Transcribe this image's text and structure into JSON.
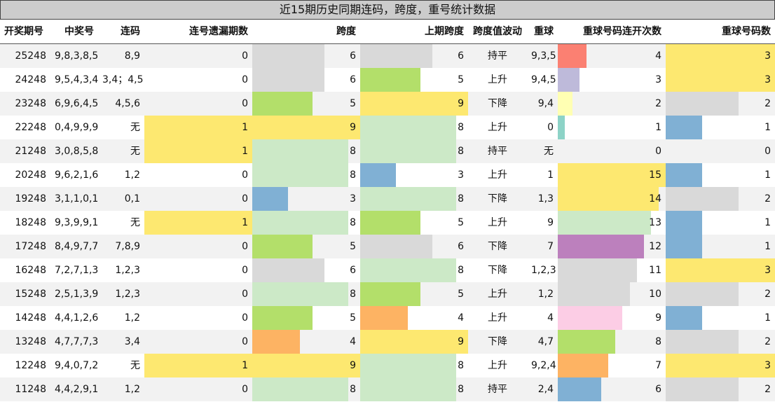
{
  "title": "近15期历史同期连码，跨度，重号统计数据",
  "headers": [
    "开奖期号",
    "中奖号",
    "连码",
    "连号遗漏期数",
    "跨度",
    "上期跨度",
    "跨度值波动",
    "重球",
    "重球号码连开次数",
    "重球号码数"
  ],
  "colors": {
    "yellow": "#fde870",
    "gray": "#d9d9d9",
    "lightgreen": "#cce9c7",
    "green": "#b3df6a",
    "blue": "#80b0d4",
    "orange": "#fdb363",
    "salmon": "#fb8072",
    "lavender": "#bebada",
    "lightyellow": "#ffffb3",
    "teal": "#8dd3c7",
    "pink": "#fccde5",
    "purple": "#bc80bd"
  },
  "rows": [
    {
      "issue": "25248",
      "numbers": "9,8,3,8,5",
      "consec": "8,9",
      "miss": "0",
      "span": "6",
      "span_color": "gray",
      "prev_span": "6",
      "prev_color": "gray",
      "trend": "持平",
      "repeat": "9,3,5",
      "repeat_times": "4",
      "times_color": "salmon",
      "repeat_count": "3",
      "count_color": "yellow"
    },
    {
      "issue": "24248",
      "numbers": "9,5,4,3,4",
      "consec": "3,4；4,5",
      "miss": "0",
      "span": "6",
      "span_color": "gray",
      "prev_span": "5",
      "prev_color": "green",
      "trend": "上升",
      "repeat": "9,4,5",
      "repeat_times": "3",
      "times_color": "lavender",
      "repeat_count": "3",
      "count_color": "yellow"
    },
    {
      "issue": "23248",
      "numbers": "6,9,6,4,5",
      "consec": "4,5,6",
      "miss": "0",
      "span": "5",
      "span_color": "green",
      "prev_span": "9",
      "prev_color": "yellow",
      "trend": "下降",
      "repeat": "9,4",
      "repeat_times": "2",
      "times_color": "lightyellow",
      "repeat_count": "2",
      "count_color": "gray"
    },
    {
      "issue": "22248",
      "numbers": "0,4,9,9,9",
      "consec": "无",
      "miss": "1",
      "span": "9",
      "span_color": "yellow",
      "prev_span": "8",
      "prev_color": "lightgreen",
      "trend": "上升",
      "repeat": "0",
      "repeat_times": "1",
      "times_color": "teal",
      "repeat_count": "1",
      "count_color": "blue"
    },
    {
      "issue": "21248",
      "numbers": "3,0,8,5,8",
      "consec": "无",
      "miss": "1",
      "span": "8",
      "span_color": "lightgreen",
      "prev_span": "8",
      "prev_color": "lightgreen",
      "trend": "持平",
      "repeat": "无",
      "repeat_times": "0",
      "times_color": "",
      "repeat_count": "0",
      "count_color": ""
    },
    {
      "issue": "20248",
      "numbers": "9,6,2,1,6",
      "consec": "1,2",
      "miss": "0",
      "span": "8",
      "span_color": "lightgreen",
      "prev_span": "3",
      "prev_color": "blue",
      "trend": "上升",
      "repeat": "1",
      "repeat_times": "15",
      "times_color": "yellow",
      "repeat_count": "1",
      "count_color": "blue"
    },
    {
      "issue": "19248",
      "numbers": "3,1,1,0,1",
      "consec": "0,1",
      "miss": "0",
      "span": "3",
      "span_color": "blue",
      "prev_span": "8",
      "prev_color": "lightgreen",
      "trend": "下降",
      "repeat": "1,3",
      "repeat_times": "14",
      "times_color": "yellow",
      "repeat_count": "2",
      "count_color": "gray"
    },
    {
      "issue": "18248",
      "numbers": "9,3,9,9,1",
      "consec": "无",
      "miss": "1",
      "span": "8",
      "span_color": "lightgreen",
      "prev_span": "5",
      "prev_color": "green",
      "trend": "上升",
      "repeat": "9",
      "repeat_times": "13",
      "times_color": "lightgreen",
      "repeat_count": "1",
      "count_color": "blue"
    },
    {
      "issue": "17248",
      "numbers": "8,4,9,7,7",
      "consec": "7,8,9",
      "miss": "0",
      "span": "5",
      "span_color": "green",
      "prev_span": "6",
      "prev_color": "gray",
      "trend": "下降",
      "repeat": "7",
      "repeat_times": "12",
      "times_color": "purple",
      "repeat_count": "1",
      "count_color": "blue"
    },
    {
      "issue": "16248",
      "numbers": "7,2,7,1,3",
      "consec": "1,2,3",
      "miss": "0",
      "span": "6",
      "span_color": "gray",
      "prev_span": "8",
      "prev_color": "lightgreen",
      "trend": "下降",
      "repeat": "1,2,3",
      "repeat_times": "11",
      "times_color": "gray",
      "repeat_count": "3",
      "count_color": "yellow"
    },
    {
      "issue": "15248",
      "numbers": "2,5,1,3,9",
      "consec": "1,2,3",
      "miss": "0",
      "span": "8",
      "span_color": "lightgreen",
      "prev_span": "5",
      "prev_color": "green",
      "trend": "上升",
      "repeat": "1,2",
      "repeat_times": "10",
      "times_color": "gray",
      "repeat_count": "2",
      "count_color": "gray"
    },
    {
      "issue": "14248",
      "numbers": "4,4,1,2,6",
      "consec": "1,2",
      "miss": "0",
      "span": "5",
      "span_color": "green",
      "prev_span": "4",
      "prev_color": "orange",
      "trend": "上升",
      "repeat": "4",
      "repeat_times": "9",
      "times_color": "pink",
      "repeat_count": "1",
      "count_color": "blue"
    },
    {
      "issue": "13248",
      "numbers": "4,7,7,7,3",
      "consec": "3,4",
      "miss": "0",
      "span": "4",
      "span_color": "orange",
      "prev_span": "9",
      "prev_color": "yellow",
      "trend": "下降",
      "repeat": "4,7",
      "repeat_times": "8",
      "times_color": "green",
      "repeat_count": "2",
      "count_color": "gray"
    },
    {
      "issue": "12248",
      "numbers": "9,4,0,7,2",
      "consec": "无",
      "miss": "1",
      "span": "9",
      "span_color": "yellow",
      "prev_span": "8",
      "prev_color": "lightgreen",
      "trend": "上升",
      "repeat": "9,2,4",
      "repeat_times": "7",
      "times_color": "orange",
      "repeat_count": "3",
      "count_color": "yellow"
    },
    {
      "issue": "11248",
      "numbers": "4,4,2,9,1",
      "consec": "1,2",
      "miss": "0",
      "span": "8",
      "span_color": "lightgreen",
      "prev_span": "8",
      "prev_color": "lightgreen",
      "trend": "持平",
      "repeat": "2,4",
      "repeat_times": "6",
      "times_color": "blue",
      "repeat_count": "2",
      "count_color": "gray"
    }
  ]
}
